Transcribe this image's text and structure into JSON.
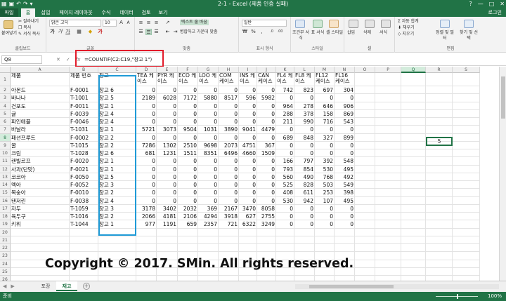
{
  "window": {
    "title": "2-1 - Excel (제품 인증 실패)",
    "qat_icons": [
      "excel-logo-icon",
      "save-icon",
      "undo-icon",
      "redo-icon",
      "customize-icon"
    ],
    "buttons": [
      "?",
      "—",
      "□",
      "✕"
    ]
  },
  "ribbon_tabs": [
    "파일",
    "홈",
    "삽입",
    "페이지 레이아웃",
    "수식",
    "데이터",
    "검토",
    "보기"
  ],
  "signin": "로그인",
  "ribbon": {
    "clipboard": {
      "paste": "붙여넣기",
      "cut": "잘라내기",
      "copy": "복사",
      "format_painter": "서식 복사",
      "label": "클립보드"
    },
    "font": {
      "name": "맑은 고딕",
      "size": "10",
      "label": "글꼴"
    },
    "alignment": {
      "wrap": "텍스트 줄 바꿈",
      "merge": "병합하고 가운데 맞춤",
      "label": "맞춤"
    },
    "number": {
      "format": "일반",
      "label": "표시 형식"
    },
    "styles": {
      "conditional": "조건부 서식",
      "table": "표 서식",
      "cell_styles": "셀 스타일",
      "label": "스타일"
    },
    "cells": {
      "insert": "삽입",
      "delete": "삭제",
      "format": "서식",
      "label": "셀"
    },
    "editing": {
      "autosum": "자동 합계",
      "fill": "채우기",
      "clear": "지우기",
      "sort": "정렬 및 필터",
      "find": "찾기 및 선택",
      "label": "편집"
    }
  },
  "formula_bar": {
    "name_box": "Q8",
    "formula": "=COUNTIF(C2:C19,\"창고 1\")"
  },
  "columns": [
    "A",
    "B",
    "C",
    "D",
    "E",
    "F",
    "G",
    "H",
    "I",
    "J",
    "K",
    "L",
    "M",
    "N",
    "O",
    "P",
    "Q",
    "R",
    "S"
  ],
  "selected_column": "Q",
  "selected_row": "8",
  "rows": [
    [
      "1",
      "제품",
      "제품 번호",
      "창고",
      "TEA 케이스",
      "PYR 케이스",
      "ECO 케이스",
      "LOO 케이스",
      "COM 케이스",
      "INS 케이스",
      "CAN 케이스",
      "FL4 케이스",
      "FL8 케이스",
      "FL12 케이스",
      "FL16 케이스"
    ],
    [
      "2",
      "아몬드",
      "F-0001",
      "창고 6",
      "0",
      "0",
      "0",
      "0",
      "0",
      "0",
      "0",
      "742",
      "823",
      "697",
      "304"
    ],
    [
      "3",
      "바나나",
      "T-1001",
      "창고 5",
      "2189",
      "6028",
      "7172",
      "5880",
      "8517",
      "596",
      "5982",
      "0",
      "0",
      "0",
      "0"
    ],
    [
      "4",
      "건포도",
      "F-0011",
      "창고 1",
      "0",
      "0",
      "0",
      "0",
      "0",
      "0",
      "0",
      "964",
      "278",
      "646",
      "906"
    ],
    [
      "5",
      "귤",
      "F-0039",
      "창고 4",
      "0",
      "0",
      "0",
      "0",
      "0",
      "0",
      "0",
      "288",
      "378",
      "158",
      "869"
    ],
    [
      "6",
      "파인애플",
      "F-0046",
      "창고 4",
      "0",
      "0",
      "0",
      "0",
      "0",
      "0",
      "0",
      "211",
      "990",
      "716",
      "543"
    ],
    [
      "7",
      "바날라",
      "T-1031",
      "창고 1",
      "5721",
      "3073",
      "9504",
      "1031",
      "3890",
      "9041",
      "4479",
      "0",
      "0",
      "0",
      "0"
    ],
    [
      "8",
      "패션프루트",
      "F-0002",
      "창고 2",
      "0",
      "0",
      "0",
      "0",
      "0",
      "0",
      "0",
      "689",
      "848",
      "327",
      "899"
    ],
    [
      "9",
      "꿀",
      "T-1015",
      "창고 2",
      "7286",
      "1302",
      "2510",
      "9698",
      "2073",
      "4751",
      "367",
      "0",
      "0",
      "0",
      "0"
    ],
    [
      "10",
      "크림",
      "T-1028",
      "창고 6",
      "681",
      "1231",
      "1511",
      "8351",
      "6496",
      "4660",
      "1509",
      "0",
      "0",
      "0",
      "0"
    ],
    [
      "11",
      "랜빌르프",
      "F-0020",
      "창고 1",
      "0",
      "0",
      "0",
      "0",
      "0",
      "0",
      "0",
      "166",
      "797",
      "392",
      "548"
    ],
    [
      "12",
      "사과(단맛)",
      "F-0021",
      "창고 1",
      "0",
      "0",
      "0",
      "0",
      "0",
      "0",
      "0",
      "793",
      "854",
      "530",
      "495"
    ],
    [
      "13",
      "코코아",
      "F-0050",
      "창고 5",
      "0",
      "0",
      "0",
      "0",
      "0",
      "0",
      "0",
      "560",
      "490",
      "768",
      "492"
    ],
    [
      "14",
      "멕아",
      "F-0052",
      "창고 3",
      "0",
      "0",
      "0",
      "0",
      "0",
      "0",
      "0",
      "525",
      "828",
      "503",
      "549"
    ],
    [
      "15",
      "복숭아",
      "F-0010",
      "창고 2",
      "0",
      "0",
      "0",
      "0",
      "0",
      "0",
      "0",
      "408",
      "611",
      "253",
      "398"
    ],
    [
      "16",
      "탠저린",
      "F-0038",
      "창고 4",
      "0",
      "0",
      "0",
      "0",
      "0",
      "0",
      "0",
      "530",
      "942",
      "107",
      "495"
    ],
    [
      "17",
      "자두",
      "T-1059",
      "창고 3",
      "3178",
      "3402",
      "2032",
      "369",
      "2167",
      "3470",
      "8058",
      "0",
      "0",
      "0",
      "0"
    ],
    [
      "18",
      "육두구",
      "T-1016",
      "창고 2",
      "2066",
      "4181",
      "2106",
      "4294",
      "3918",
      "627",
      "2755",
      "0",
      "0",
      "0",
      "0"
    ],
    [
      "19",
      "키위",
      "T-1044",
      "창고 1",
      "977",
      "1191",
      "659",
      "2357",
      "721",
      "6322",
      "3249",
      "0",
      "0",
      "0",
      "0"
    ]
  ],
  "empty_rows": [
    "20",
    "21",
    "22",
    "23",
    "24",
    "25",
    "26",
    "27",
    "28",
    "29"
  ],
  "active_cell_value": "5",
  "copyright": "Copyright © 2017. SMin. All rights reserved.",
  "sheet_tabs": [
    "포장",
    "재고"
  ],
  "active_sheet": "재고",
  "status": {
    "ready": "준비",
    "zoom": "100%"
  }
}
